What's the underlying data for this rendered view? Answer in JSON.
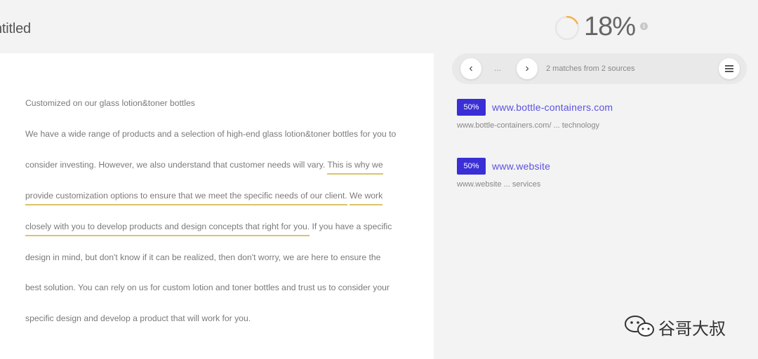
{
  "doc": {
    "title": "ntitled",
    "lines": [
      {
        "segments": [
          {
            "text": "Customized on our glass lotion&toner bottles",
            "hl": false
          }
        ]
      },
      {
        "segments": [
          {
            "text": "We have a wide range of products and a selection of high-end glass lotion&toner bottles for you to",
            "hl": false
          }
        ]
      },
      {
        "segments": [
          {
            "text": "consider investing. However, we also understand that customer needs will vary. ",
            "hl": false
          },
          {
            "text": "This is why we",
            "hl": true
          }
        ]
      },
      {
        "segments": [
          {
            "text": "provide customization options to ensure that we meet the specific needs of our client.",
            "hl": true
          },
          {
            "text": " ",
            "hl": false
          },
          {
            "text": "We work",
            "hl": true
          }
        ]
      },
      {
        "segments": [
          {
            "text": "closely with you to develop products and design concepts that right for you.",
            "hl": true
          },
          {
            "text": " If you have a specific",
            "hl": false
          }
        ]
      },
      {
        "segments": [
          {
            "text": "design in mind, but don't know if it can be realized, then don't worry, we are here to ensure the",
            "hl": false
          }
        ]
      },
      {
        "segments": [
          {
            "text": "best solution. You can rely on us for custom lotion and toner bottles and trust us to consider your",
            "hl": false
          }
        ]
      },
      {
        "segments": [
          {
            "text": "specific design and develop a product that will work for you.",
            "hl": false
          }
        ]
      }
    ]
  },
  "score": {
    "value": "18%",
    "percent": 18,
    "info_icon": "i"
  },
  "nav": {
    "prev_icon": "‹",
    "next_icon": "›",
    "dots": "...",
    "matches_text": "2 matches from 2 sources",
    "menu_icon": "hamburger-menu-icon"
  },
  "matches": [
    {
      "percent": "50%",
      "url": "www.bottle-containers.com",
      "sub": "www.bottle-containers.com/ ... technology"
    },
    {
      "percent": "50%",
      "url": "www.website",
      "sub": "www.website ... services"
    }
  ],
  "watermark": {
    "text": "谷哥大叔",
    "icon": "wechat-icon"
  },
  "colors": {
    "accent": "#3a2fd6",
    "highlight": "#d9c46a",
    "ring": "#f2b14a"
  }
}
